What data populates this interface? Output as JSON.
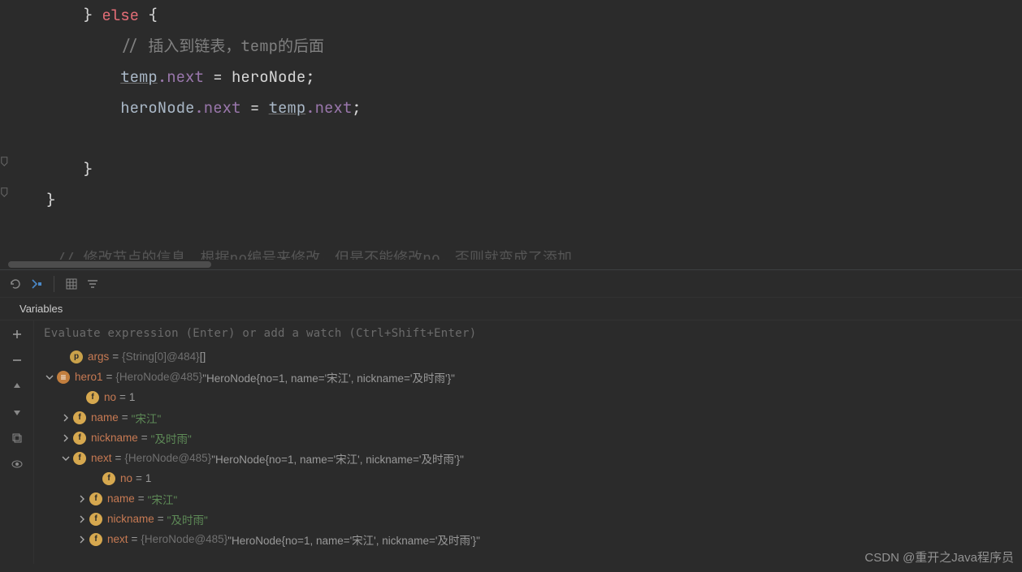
{
  "editor": {
    "line1_brace": "}",
    "line1_else": "else",
    "line1_open": "{",
    "line2_comment": "// 插入到链表，temp的后面",
    "line3_temp": "temp",
    "line3_next": ".next",
    "line3_eq": " = heroNode;",
    "line4_hero": "heroNode",
    "line4_next1": ".next",
    "line4_eq": " = ",
    "line4_temp": "temp",
    "line4_next2": ".next",
    "line4_semi": ";",
    "line5_brace": "}",
    "line6_brace": "}",
    "faded": "// 修改节点的信息，根据no编号来修改，但是不能修改no，否则就变成了添加"
  },
  "debug": {
    "tab_variables": "Variables",
    "watch_hint": "Evaluate expression (Enter) or add a watch (Ctrl+Shift+Enter)"
  },
  "vars": {
    "args": {
      "name": "args",
      "type": "{String[0]@484}",
      "val": "[]"
    },
    "hero1": {
      "name": "hero1",
      "type": "{HeroNode@485}",
      "val": "\"HeroNode{no=1, name='宋江', nickname='及时雨'}\""
    },
    "no1": {
      "name": "no",
      "val": "1"
    },
    "name1": {
      "name": "name",
      "val": "\"宋江\""
    },
    "nickname1": {
      "name": "nickname",
      "val": "\"及时雨\""
    },
    "next1": {
      "name": "next",
      "type": "{HeroNode@485}",
      "val": "\"HeroNode{no=1, name='宋江', nickname='及时雨'}\""
    },
    "no2": {
      "name": "no",
      "val": "1"
    },
    "name2": {
      "name": "name",
      "val": "\"宋江\""
    },
    "nickname2": {
      "name": "nickname",
      "val": "\"及时雨\""
    },
    "next2": {
      "name": "next",
      "type": "{HeroNode@485}",
      "val": "\"HeroNode{no=1, name='宋江', nickname='及时雨'}\""
    }
  },
  "watermark": "CSDN @重开之Java程序员"
}
